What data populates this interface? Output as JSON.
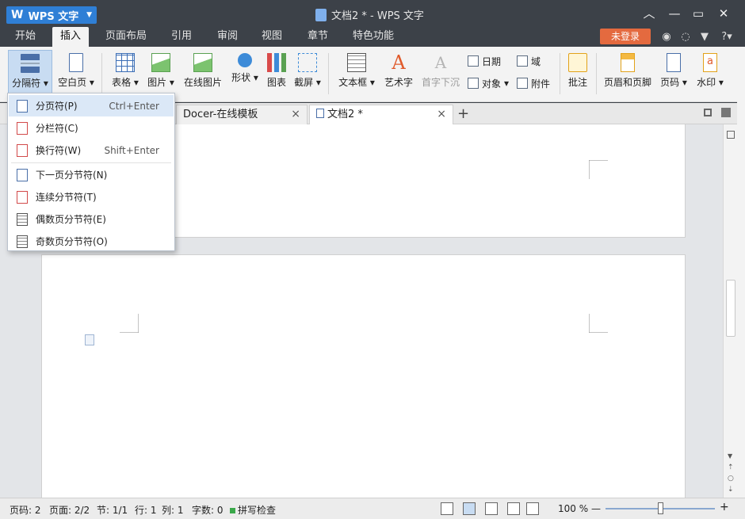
{
  "app": {
    "menu_button": "WPS 文字",
    "logo_glyph": "W",
    "window_title": "文档2 * - WPS 文字"
  },
  "menubar": {
    "tabs": [
      "开始",
      "插入",
      "页面布局",
      "引用",
      "审阅",
      "视图",
      "章节",
      "特色功能"
    ],
    "active_tab": "插入",
    "login": "未登录",
    "help": "?"
  },
  "ribbon": {
    "break": "分隔符",
    "blank_page": "空白页",
    "table": "表格",
    "picture": "图片",
    "online_picture": "在线图片",
    "shape": "形状",
    "chart": "图表",
    "screenshot": "截屏",
    "textbox": "文本框",
    "wordart": "艺术字",
    "drop_cap": "首字下沉",
    "date": "日期",
    "field": "域",
    "object": "对象",
    "attachment": "附件",
    "comment": "批注",
    "header_footer": "页眉和页脚",
    "page_number": "页码",
    "watermark": "水印"
  },
  "doctabs": [
    {
      "label": "Docer-在线模板",
      "close": "×"
    },
    {
      "label": "文档2 *",
      "close": "×"
    }
  ],
  "dropdown": [
    {
      "label": "分页符(P)",
      "shortcut": "Ctrl+Enter"
    },
    {
      "label": "分栏符(C)",
      "shortcut": ""
    },
    {
      "label": "换行符(W)",
      "shortcut": "Shift+Enter"
    },
    {
      "label": "下一页分节符(N)",
      "shortcut": ""
    },
    {
      "label": "连续分节符(T)",
      "shortcut": ""
    },
    {
      "label": "偶数页分节符(E)",
      "shortcut": ""
    },
    {
      "label": "奇数页分节符(O)",
      "shortcut": ""
    }
  ],
  "status": {
    "page_no": "页码: 2",
    "pages": "页面: 2/2",
    "section": "节: 1/1",
    "row": "行: 1",
    "col": "列: 1",
    "word_count": "字数: 0",
    "spell_check": "拼写检查",
    "zoom": "100 %",
    "zoom_minus": "—",
    "zoom_plus": "+"
  },
  "icons": [
    "wps-logo-icon",
    "minimize-icon",
    "maximize-icon",
    "close-icon",
    "skin-icon",
    "feedback-icon",
    "shirt-icon",
    "help-icon"
  ],
  "colors": {
    "titlebar": "#3c4148",
    "app_button": "#2f7fd6",
    "login_button": "#e46a3f",
    "ribbon": "#f3f3f3",
    "selection": "#dbe8f7"
  }
}
